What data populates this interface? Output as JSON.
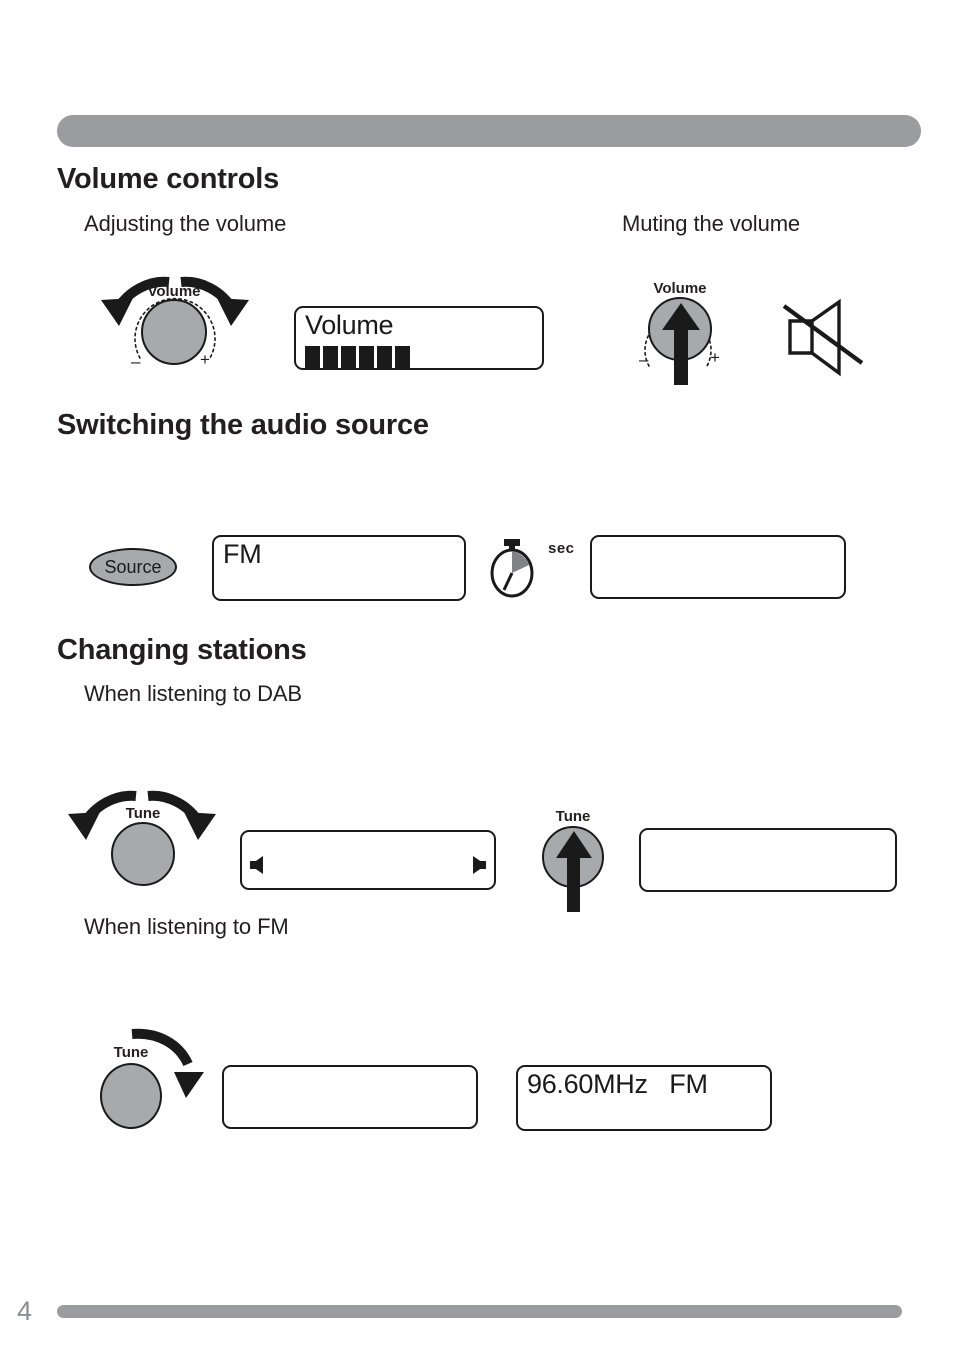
{
  "page": {
    "number": "4",
    "top_bar_color": "#9b9c9f",
    "bottom_bar_color": "#9b9c9f",
    "knob_fill_color": "#a7a9ac",
    "ink_color": "#231f20"
  },
  "sections": {
    "volume": {
      "heading": "Volume controls",
      "adjust": {
        "subheading": "Adjusting the volume",
        "knob_label": "Volume",
        "minus": "–",
        "plus": "+",
        "display_text": "Volume",
        "level_bars": 6
      },
      "mute": {
        "subheading": "Muting the volume",
        "knob_label": "Volume",
        "minus": "–",
        "plus": "+",
        "icon": "speaker-muted-icon"
      }
    },
    "source": {
      "heading": "Switching the audio source",
      "button_label": "Source",
      "display_text": "FM",
      "timer_label": "sec",
      "timer_icon": "stopwatch-icon",
      "result_display_text": ""
    },
    "stations": {
      "heading": "Changing stations",
      "dab": {
        "subheading": "When listening to DAB",
        "rotate_knob_label": "Tune",
        "display_text": "",
        "press_knob_label": "Tune",
        "result_display_text": ""
      },
      "fm": {
        "subheading": "When listening to FM",
        "rotate_knob_label": "Tune",
        "display_text": "",
        "result_display_text": "96.60MHz   FM"
      }
    }
  }
}
